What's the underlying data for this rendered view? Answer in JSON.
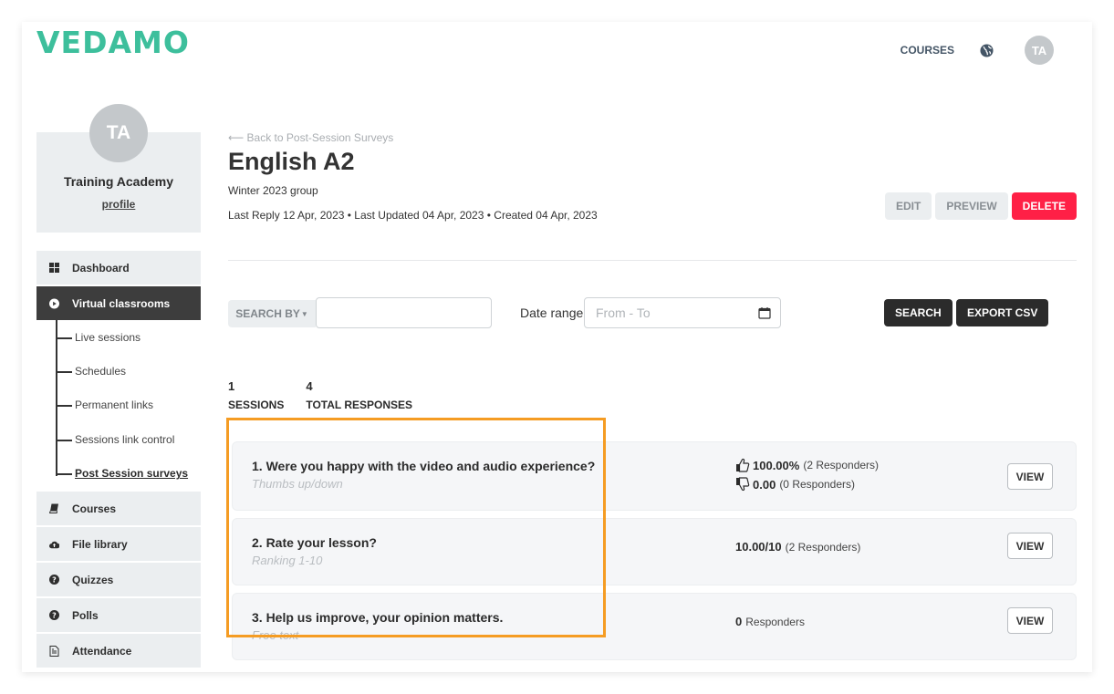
{
  "header": {
    "logo": "VEDAMO",
    "nav_courses": "COURSES",
    "avatar_initials": "TA"
  },
  "sidebar": {
    "profile": {
      "initials": "TA",
      "name": "Training Academy",
      "link": "profile"
    },
    "items": [
      {
        "label": "Dashboard",
        "icon": "grid-icon"
      },
      {
        "label": "Virtual classrooms",
        "icon": "play-circle-icon",
        "active": true
      },
      {
        "label": "Courses",
        "icon": "book-icon"
      },
      {
        "label": "File library",
        "icon": "cloud-upload-icon"
      },
      {
        "label": "Quizzes",
        "icon": "question-circle-icon"
      },
      {
        "label": "Polls",
        "icon": "question-circle-icon"
      },
      {
        "label": "Attendance",
        "icon": "document-icon"
      }
    ],
    "subitems": [
      {
        "label": "Live sessions"
      },
      {
        "label": "Schedules"
      },
      {
        "label": "Permanent links"
      },
      {
        "label": "Sessions link control"
      },
      {
        "label": "Post Session surveys",
        "current": true
      }
    ]
  },
  "main": {
    "back_link": "Back to Post-Session Surveys",
    "title": "English A2",
    "subtitle": "Winter 2023 group",
    "meta": "Last Reply 12 Apr, 2023 • Last Updated 04 Apr, 2023 • Created 04 Apr, 2023",
    "actions": {
      "edit": "EDIT",
      "preview": "PREVIEW",
      "delete": "DELETE"
    },
    "filters": {
      "search_by": "SEARCH BY",
      "search_value": "",
      "date_label": "Date range",
      "date_placeholder": "From - To",
      "search_button": "SEARCH",
      "export_button": "EXPORT CSV"
    },
    "stats": [
      {
        "value": "1",
        "label": "SESSIONS"
      },
      {
        "value": "4",
        "label": "TOTAL RESPONSES"
      }
    ],
    "questions": [
      {
        "title": "1. Were you happy with the video and audio experience?",
        "type": "Thumbs up/down",
        "results": [
          {
            "icon": "thumbs-up-icon",
            "value": "100.00%",
            "detail": "(2 Responders)"
          },
          {
            "icon": "thumbs-down-icon",
            "value": "0.00",
            "detail": "(0 Responders)"
          }
        ],
        "button": "VIEW"
      },
      {
        "title": "2. Rate your lesson?",
        "type": "Ranking 1-10",
        "results": [
          {
            "value": "10.00/10",
            "detail": "(2 Responders)"
          }
        ],
        "button": "VIEW"
      },
      {
        "title": "3. Help us improve, your opinion matters.",
        "type": "Free text",
        "results": [
          {
            "value": "0",
            "detail": "Responders"
          }
        ],
        "button": "VIEW"
      }
    ]
  },
  "colors": {
    "brand": "#3dbf9c",
    "danger": "#ff2046",
    "dark": "#2b2b2b",
    "highlight": "#f59c23",
    "sidebar_active": "#3d3d3d"
  }
}
